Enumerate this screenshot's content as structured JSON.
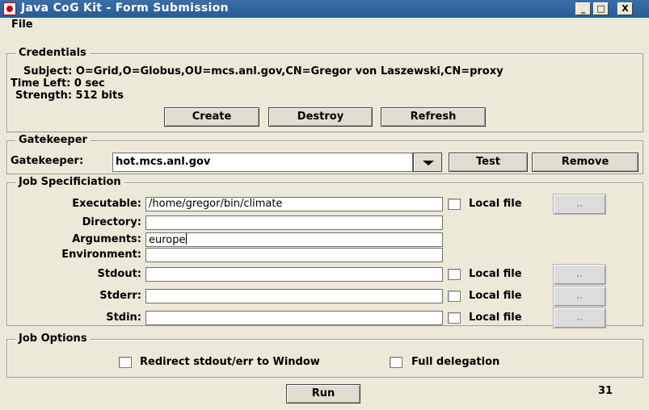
{
  "window": {
    "title": "Java CoG Kit - Form Submission",
    "minimize": "_",
    "maximize": "□",
    "close": "X"
  },
  "menu": {
    "file_label": "File"
  },
  "credentials": {
    "legend": "Credentials",
    "subject": "Subject: O=Grid,O=Globus,OU=mcs.anl.gov,CN=Gregor von Laszewski,CN=proxy",
    "time_left": "Time Left: 0 sec",
    "strength": "Strength: 512 bits",
    "create_label": "Create",
    "destroy_label": "Destroy",
    "refresh_label": "Refresh"
  },
  "gatekeeper": {
    "legend": "Gatekeeper",
    "label": "Gatekeeper:",
    "value": "hot.mcs.anl.gov",
    "test_label": "Test",
    "remove_label": "Remove"
  },
  "job_spec": {
    "legend": "Job Specificiation",
    "executable_label": "Executable:",
    "executable_value": "/home/gregor/bin/climate",
    "directory_label": "Directory:",
    "directory_value": "",
    "arguments_label": "Arguments:",
    "arguments_value": "europe",
    "environment_label": "Environment:",
    "environment_value": "",
    "stdout_label": "Stdout:",
    "stdout_value": "",
    "stderr_label": "Stderr:",
    "stderr_value": "",
    "stdin_label": "Stdin:",
    "stdin_value": "",
    "local_file_label": "Local file",
    "browse_label": ".."
  },
  "job_options": {
    "legend": "Job Options",
    "redirect_label": "Redirect stdout/err to Window",
    "full_delegation_label": "Full delegation"
  },
  "run_label": "Run",
  "page_number": "31"
}
